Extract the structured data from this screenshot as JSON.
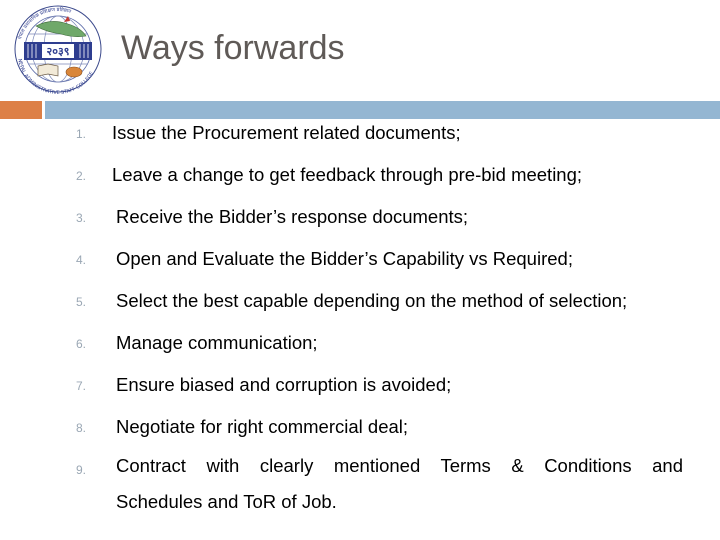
{
  "slide": {
    "title": "Ways forwards",
    "logo": {
      "name": "Nepal Administrative Staff College emblem",
      "ring_text_bottom": "NEPAL ADMINISTRATIVE STAFF COLLEGE",
      "band_text": "२०३९"
    },
    "colors": {
      "accent_orange": "#dd8047",
      "accent_blue": "#94b6d2",
      "title": "#5f5a57",
      "number": "#9aa7b4",
      "body_text": "#000000"
    },
    "items": [
      {
        "number": "1.",
        "text": "Issue the Procurement related documents;"
      },
      {
        "number": "2.",
        "text": "Leave a change to get feedback through pre-bid meeting;"
      },
      {
        "number": "3.",
        "text": "Receive the Bidder’s response documents;"
      },
      {
        "number": "4.",
        "text": "Open and Evaluate the Bidder’s Capability vs Required;"
      },
      {
        "number": "5.",
        "text": "Select the best capable depending on the method of selection;"
      },
      {
        "number": "6.",
        "text": "Manage communication;"
      },
      {
        "number": "7.",
        "text": "Ensure biased and corruption is avoided;"
      },
      {
        "number": "8.",
        "text": "Negotiate for right commercial deal;"
      },
      {
        "number": "9.",
        "text_line1": "Contract with clearly mentioned Terms & Conditions and",
        "text_line2": "Schedules and ToR of Job."
      }
    ]
  }
}
